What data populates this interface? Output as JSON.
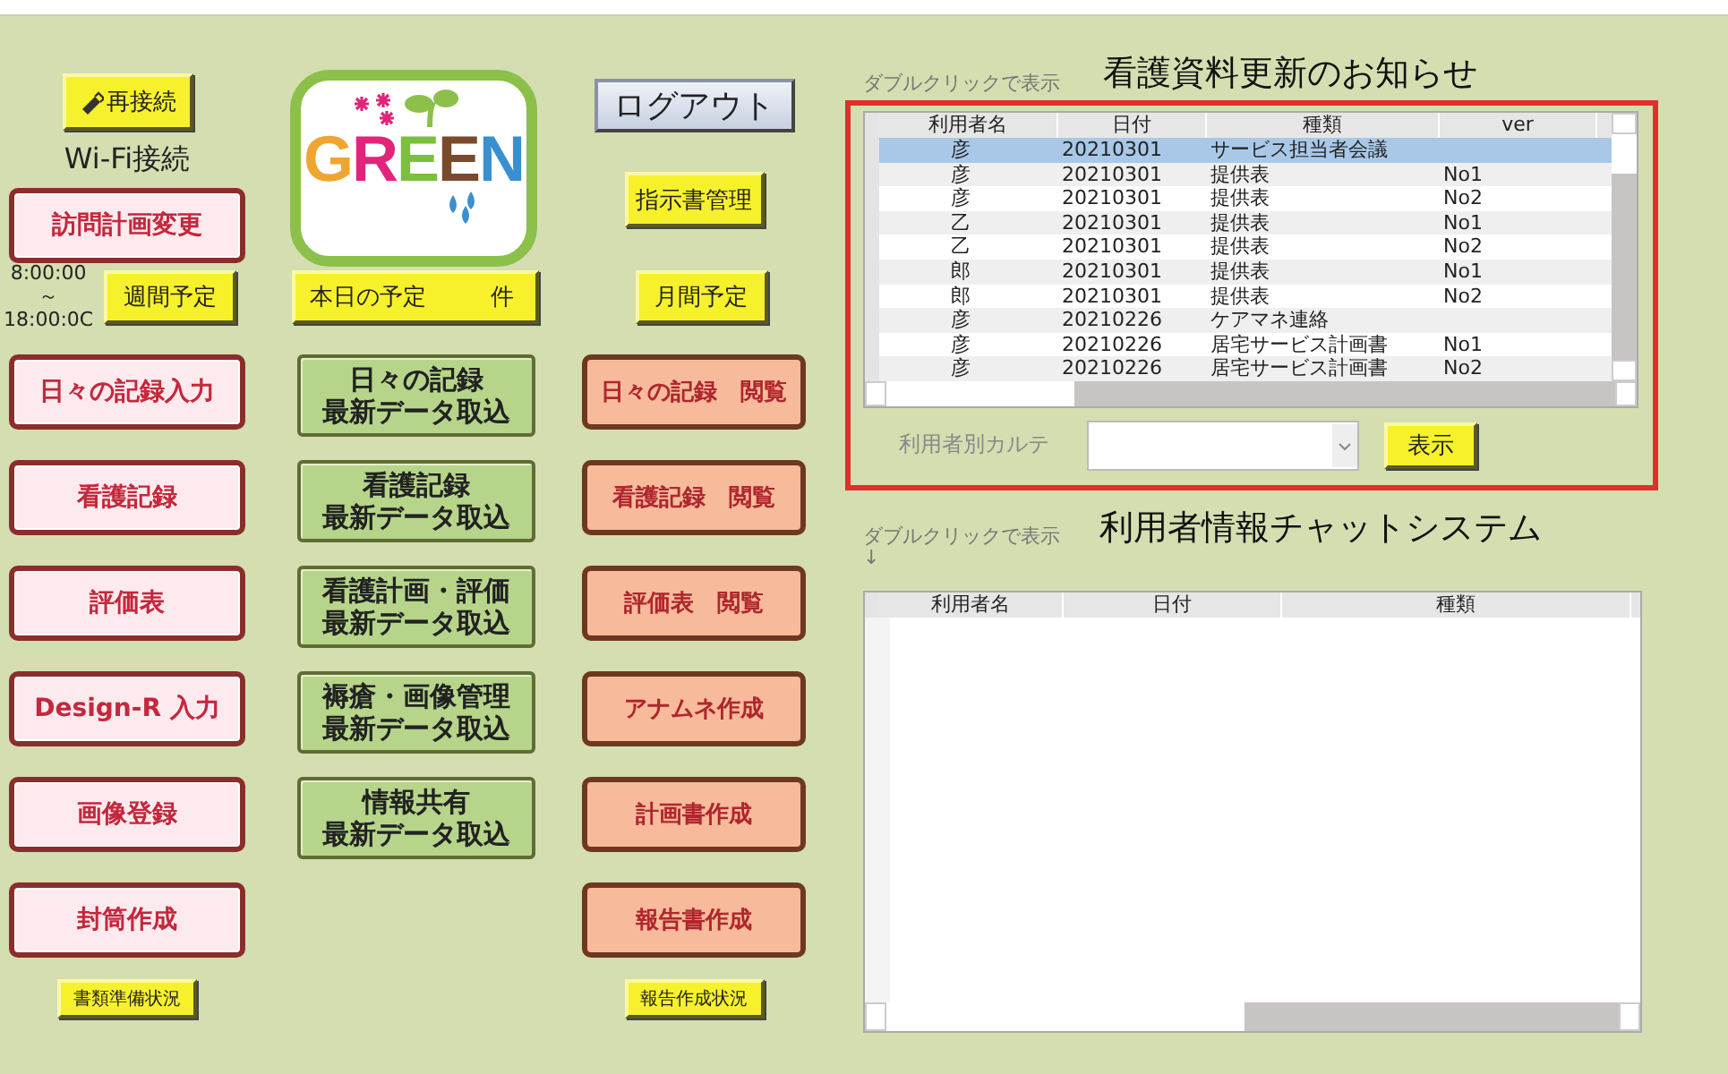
{
  "left_panel": {
    "reconnect_button": {
      "label": "再接続"
    },
    "wifi_label": "Wi-Fi接続",
    "visit_plan_button": {
      "label": "訪問計画変更"
    },
    "time_range": {
      "start": "8:00:00",
      "separator": "～",
      "end": "18:00:0C"
    },
    "weekly_button": {
      "label": "週間予定"
    },
    "today_button": {
      "label": "本日の予定",
      "suffix": "件"
    },
    "logo": {
      "letters": [
        {
          "char": "G",
          "color": "#f0a531"
        },
        {
          "char": "R",
          "color": "#e0257a"
        },
        {
          "char": "E",
          "color": "#7cbf3c"
        },
        {
          "char": "E",
          "color": "#7a4a2c"
        },
        {
          "char": "N",
          "color": "#3a8fd0"
        }
      ]
    },
    "logout_button": {
      "label": "ログアウト"
    },
    "instructions_button": {
      "label": "指示書管理"
    },
    "monthly_button": {
      "label": "月間予定"
    },
    "input_buttons": [
      {
        "label": "日々の記録入力"
      },
      {
        "label": "看護記録"
      },
      {
        "label": "評価表"
      },
      {
        "label": "Design-R 入力"
      },
      {
        "label": "画像登録"
      },
      {
        "label": "封筒作成"
      }
    ],
    "import_buttons": [
      {
        "lines": [
          "日々の記録",
          "最新データ取込"
        ]
      },
      {
        "lines": [
          "看護記録",
          "最新データ取込"
        ]
      },
      {
        "lines": [
          "看護計画・評価",
          "最新データ取込"
        ]
      },
      {
        "lines": [
          "褥瘡・画像管理",
          "最新データ取込"
        ]
      },
      {
        "lines": [
          "情報共有",
          "最新データ取込"
        ]
      }
    ],
    "view_buttons": [
      {
        "label": "日々の記録　閲覧"
      },
      {
        "label": "看護記録　閲覧"
      },
      {
        "label": "評価表　閲覧"
      },
      {
        "label": "アナムネ作成"
      },
      {
        "label": "計画書作成"
      },
      {
        "label": "報告書作成"
      }
    ],
    "documents_status_button": {
      "label": "書類準備状況"
    },
    "report_status_button": {
      "label": "報告作成状況"
    }
  },
  "notice": {
    "hint": "ダブルクリックで表示",
    "title": "看護資料更新のお知らせ",
    "table": {
      "columns": [
        "利用者名",
        "日付",
        "種類",
        "ver"
      ],
      "rows": [
        {
          "cells": [
            "彦",
            "20210301",
            "サービス担当者会議",
            ""
          ],
          "selected": true
        },
        {
          "cells": [
            "彦",
            "20210301",
            "提供表",
            "No1"
          ],
          "selected": false
        },
        {
          "cells": [
            "彦",
            "20210301",
            "提供表",
            "No2"
          ],
          "selected": false
        },
        {
          "cells": [
            "乙",
            "20210301",
            "提供表",
            "No1"
          ],
          "selected": false
        },
        {
          "cells": [
            "乙",
            "20210301",
            "提供表",
            "No2"
          ],
          "selected": false
        },
        {
          "cells": [
            "郎",
            "20210301",
            "提供表",
            "No1"
          ],
          "selected": false
        },
        {
          "cells": [
            "郎",
            "20210301",
            "提供表",
            "No2"
          ],
          "selected": false
        },
        {
          "cells": [
            "彦",
            "20210226",
            "ケアマネ連絡",
            ""
          ],
          "selected": false
        },
        {
          "cells": [
            "彦",
            "20210226",
            "居宅サービス計画書",
            "No1"
          ],
          "selected": false
        },
        {
          "cells": [
            "彦",
            "20210226",
            "居宅サービス計画書",
            "No2"
          ],
          "selected": false
        }
      ]
    },
    "karte_label": "利用者別カルテ",
    "show_button": {
      "label": "表示"
    }
  },
  "chat": {
    "hint": "ダブルクリックで表示",
    "hint_arrow": "↓",
    "title": "利用者情報チャットシステム",
    "table": {
      "columns": [
        "利用者名",
        "日付",
        "種類"
      ]
    }
  }
}
